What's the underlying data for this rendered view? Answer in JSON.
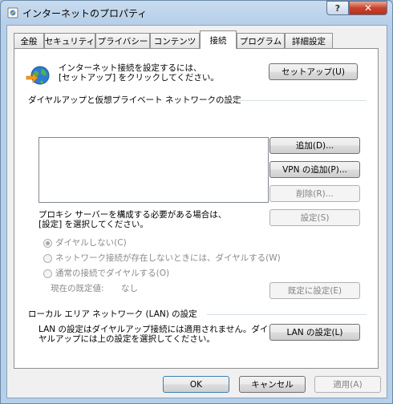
{
  "window": {
    "title": "インターネットのプロパティ",
    "help_label": "?",
    "close_label": "✕"
  },
  "tabs": [
    {
      "label": "全般"
    },
    {
      "label": "セキュリティ"
    },
    {
      "label": "プライバシー"
    },
    {
      "label": "コンテンツ"
    },
    {
      "label": "接続",
      "active": true
    },
    {
      "label": "プログラム"
    },
    {
      "label": "詳細設定"
    }
  ],
  "setup": {
    "text_line1": "インターネット接続を設定するには、",
    "text_line2": "[セットアップ] をクリックしてください。",
    "button": "セットアップ(U)"
  },
  "dialup": {
    "heading": "ダイヤルアップと仮想プライベート ネットワークの設定",
    "add_button": "追加(D)...",
    "add_vpn_button": "VPN の追加(P)...",
    "remove_button": "削除(R)...",
    "settings_button": "設定(S)",
    "proxy_line1": "プロキシ サーバーを構成する必要がある場合は、",
    "proxy_line2": "[設定] を選択してください。",
    "radio_never": "ダイヤルしない(C)",
    "radio_when_no_network": "ネットワーク接続が存在しないときには、ダイヤルする(W)",
    "radio_always": "通常の接続でダイヤルする(O)",
    "default_label": "現在の既定値:",
    "default_value": "なし",
    "set_default_button": "既定に設定(E)"
  },
  "lan": {
    "heading": "ローカル エリア ネットワーク (LAN) の設定",
    "text_line1": "LAN の設定はダイヤルアップ接続には適用されません。ダイ",
    "text_line2": "ヤルアップには上の設定を選択してください。",
    "button": "LAN の設定(L)"
  },
  "footer": {
    "ok": "OK",
    "cancel": "キャンセル",
    "apply": "適用(A)"
  },
  "colors": {
    "accent": "#3c7fb1",
    "close": "#c7432c"
  }
}
